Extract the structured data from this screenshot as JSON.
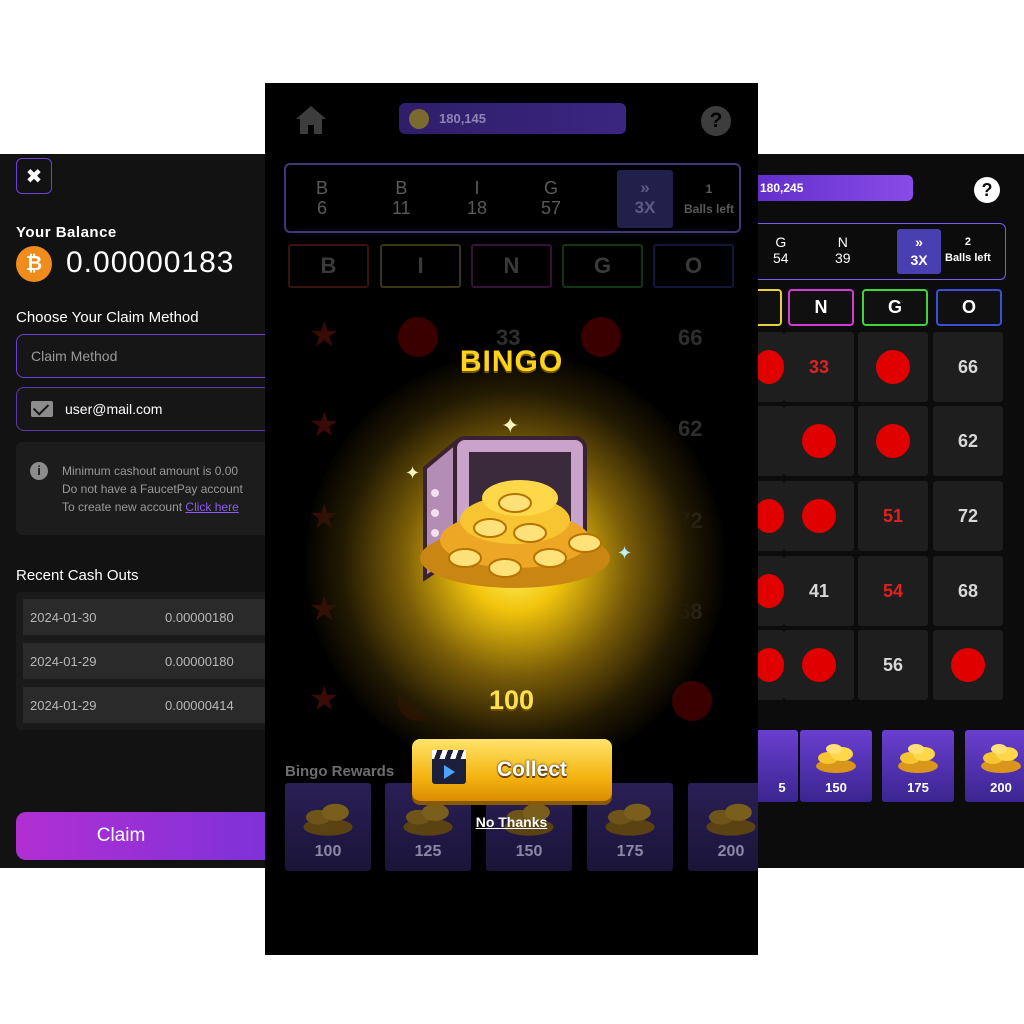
{
  "wallet": {
    "close_label": "✖",
    "balance_label": "Your Balance",
    "btc_symbol": "₿",
    "balance_value": "0.00000183",
    "method_label": "Choose Your Claim Method",
    "method_placeholder": "Claim Method",
    "email_value": "user@mail.com",
    "info_icon": "i",
    "info_lines": [
      "Minimum cashout amount is 0.00",
      "Do not have a FaucetPay account",
      "To create new account "
    ],
    "info_link": "Click here",
    "recent_label": "Recent Cash Outs",
    "cashouts": [
      {
        "date": "2024-01-30",
        "amount": "0.00000180"
      },
      {
        "date": "2024-01-29",
        "amount": "0.00000180"
      },
      {
        "date": "2024-01-29",
        "amount": "0.00000414"
      }
    ],
    "claim_label": "Claim"
  },
  "game": {
    "coins": "180,145",
    "help_label": "?",
    "balls": [
      {
        "letter": "B",
        "number": "6"
      },
      {
        "letter": "B",
        "number": "11"
      },
      {
        "letter": "I",
        "number": "18"
      },
      {
        "letter": "G",
        "number": "57"
      }
    ],
    "multiplier_arrows": "»",
    "multiplier": "3X",
    "balls_left_count": "1",
    "balls_left_label": "Balls left",
    "headers": [
      "B",
      "I",
      "N",
      "G",
      "O"
    ],
    "dim_numbers": [
      "33",
      "66",
      "62",
      "72",
      "68",
      "56"
    ],
    "popup_title": "BINGO",
    "prize": "100",
    "collect_label": "Collect",
    "no_thanks_label": "No Thanks",
    "rewards_label": "Bingo Rewards",
    "rewards": [
      "100",
      "125",
      "150",
      "175",
      "200"
    ]
  },
  "board": {
    "coins": "180,245",
    "help_label": "?",
    "balls": [
      {
        "letter": "G",
        "number": "54"
      },
      {
        "letter": "N",
        "number": "39"
      }
    ],
    "multiplier_arrows": "»",
    "multiplier": "3X",
    "balls_left_count": "2",
    "balls_left_label": "Balls left",
    "headers": [
      "N",
      "G",
      "O"
    ],
    "cells": {
      "r1": [
        "33",
        "66"
      ],
      "r2": [
        "62"
      ],
      "r3": [
        "51",
        "72"
      ],
      "r4": [
        "41",
        "54",
        "68"
      ],
      "r5": [
        "56"
      ]
    },
    "rewards": [
      "5",
      "150",
      "175",
      "200"
    ]
  },
  "colors": {
    "accent_purple": "#6e3fd8",
    "claim_gradient_start": "#b12fd3",
    "btc_orange": "#f08c1c",
    "marked_red": "#e00000",
    "gold": "#ffd21e",
    "header_b": "#d23a2a",
    "header_i": "#e8d238",
    "header_n": "#d43ad4",
    "header_g": "#3fd43a",
    "header_o": "#3a4fd4"
  },
  "icons": [
    "close-icon",
    "bitcoin-icon",
    "mail-icon",
    "info-icon",
    "home-icon",
    "coin-icon",
    "help-icon",
    "clapperboard-icon",
    "coin-pile-icon",
    "treasure-safe-icon",
    "star-icon"
  ]
}
